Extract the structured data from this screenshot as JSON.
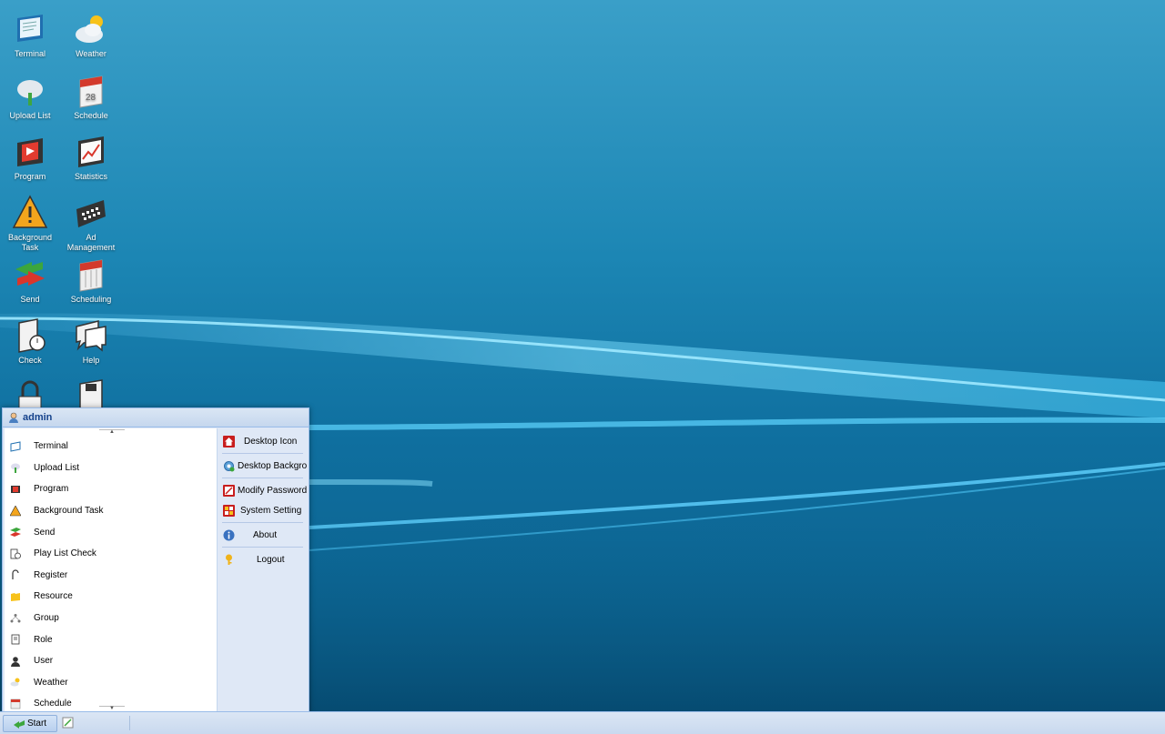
{
  "desktop": {
    "icons": [
      {
        "label": "Terminal",
        "icon": "terminal-icon"
      },
      {
        "label": "Weather",
        "icon": "weather-icon"
      },
      {
        "label": "Upload List",
        "icon": "upload-list-icon"
      },
      {
        "label": "Schedule",
        "icon": "schedule-icon"
      },
      {
        "label": "Program",
        "icon": "program-icon"
      },
      {
        "label": "Statistics",
        "icon": "statistics-icon"
      },
      {
        "label": "Background Task",
        "icon": "background-task-icon"
      },
      {
        "label": "Ad Management",
        "icon": "ad-management-icon"
      },
      {
        "label": "Send",
        "icon": "send-icon"
      },
      {
        "label": "Scheduling",
        "icon": "scheduling-icon"
      },
      {
        "label": "Check",
        "icon": "check-icon"
      },
      {
        "label": "Help",
        "icon": "help-icon"
      },
      {
        "label": "",
        "icon": "lock-icon"
      },
      {
        "label": "",
        "icon": "save-icon"
      }
    ]
  },
  "start_menu": {
    "user": "admin",
    "items": [
      {
        "label": "Terminal",
        "icon": "terminal-icon"
      },
      {
        "label": "Upload List",
        "icon": "upload-list-icon"
      },
      {
        "label": "Program",
        "icon": "program-icon"
      },
      {
        "label": "Background Task",
        "icon": "background-task-icon"
      },
      {
        "label": "Send",
        "icon": "send-icon"
      },
      {
        "label": "Play List Check",
        "icon": "play-list-check-icon"
      },
      {
        "label": "Register",
        "icon": "register-icon"
      },
      {
        "label": "Resource",
        "icon": "resource-icon"
      },
      {
        "label": "Group",
        "icon": "group-icon"
      },
      {
        "label": "Role",
        "icon": "role-icon"
      },
      {
        "label": "User",
        "icon": "user-icon"
      },
      {
        "label": "Weather",
        "icon": "weather-icon"
      },
      {
        "label": "Schedule",
        "icon": "schedule-icon"
      }
    ],
    "tools": [
      {
        "label": "Desktop Icon",
        "icon": "home-icon"
      },
      {
        "label": "Desktop Backgrou",
        "icon": "gear-icon"
      },
      {
        "label": "Modify Password",
        "icon": "edit-password-icon"
      },
      {
        "label": "System Setting",
        "icon": "system-setting-icon"
      },
      {
        "label": "About",
        "icon": "info-icon"
      },
      {
        "label": "Logout",
        "icon": "key-icon"
      }
    ]
  },
  "taskbar": {
    "start_label": "Start",
    "quick_icon": "edit-icon"
  },
  "colors": {
    "accent": "#15428b",
    "menu_bg": "#dfe8f6",
    "menu_border": "#99bbe8"
  }
}
